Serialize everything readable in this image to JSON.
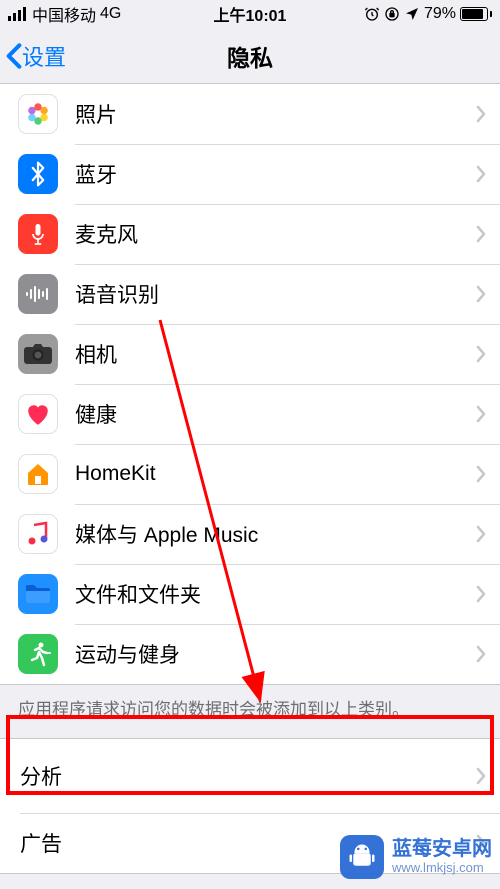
{
  "status": {
    "carrier": "中国移动",
    "network": "4G",
    "time": "上午10:01",
    "alarm_icon": "⏰",
    "orientation_lock_icon": "🔒",
    "location_icon": "➤",
    "battery_pct": "79%"
  },
  "nav": {
    "back_label": "设置",
    "title": "隐私"
  },
  "rows_group1": [
    {
      "key": "photos",
      "label": "照片"
    },
    {
      "key": "bluetooth",
      "label": "蓝牙"
    },
    {
      "key": "mic",
      "label": "麦克风"
    },
    {
      "key": "speech",
      "label": "语音识别"
    },
    {
      "key": "camera",
      "label": "相机"
    },
    {
      "key": "health",
      "label": "健康"
    },
    {
      "key": "homekit",
      "label": "HomeKit"
    },
    {
      "key": "music",
      "label": "媒体与 Apple Music"
    },
    {
      "key": "files",
      "label": "文件和文件夹"
    },
    {
      "key": "activity",
      "label": "运动与健身"
    }
  ],
  "footer1": "应用程序请求访问您的数据时会被添加到以上类别。",
  "rows_group2": [
    {
      "key": "analytics",
      "label": "分析"
    },
    {
      "key": "ads",
      "label": "广告"
    }
  ],
  "annotation": {
    "highlight_target": "analytics",
    "color": "#ff0000"
  },
  "watermark": {
    "line1": "蓝莓安卓网",
    "line2": "www.lmkjsj.com"
  }
}
